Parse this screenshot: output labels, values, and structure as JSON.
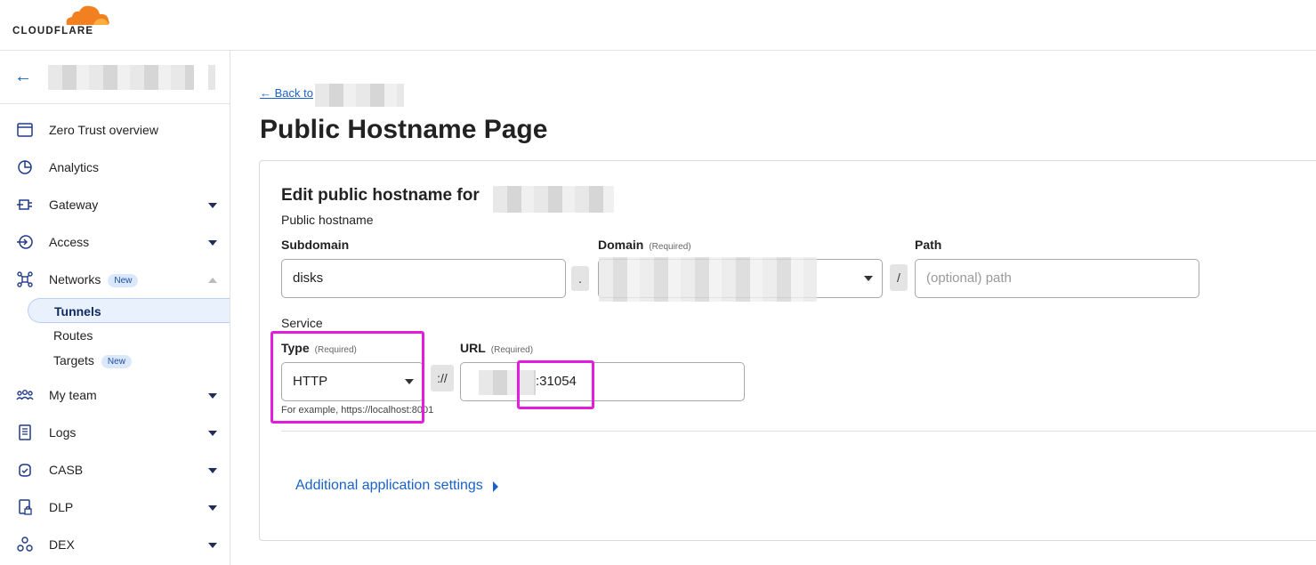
{
  "brand": {
    "logo_text": "CLOUDFLARE",
    "logo_color": "#f38020"
  },
  "sidebar": {
    "items": [
      {
        "label": "Zero Trust overview",
        "icon": "browser-window-icon",
        "caret": false
      },
      {
        "label": "Analytics",
        "icon": "pie-chart-icon",
        "caret": false
      },
      {
        "label": "Gateway",
        "icon": "gateway-icon",
        "caret": true
      },
      {
        "label": "Access",
        "icon": "access-login-icon",
        "caret": true
      },
      {
        "label": "Networks",
        "badge": "New",
        "icon": "network-icon",
        "caret": true,
        "expanded": true
      },
      {
        "label": "My team",
        "icon": "team-icon",
        "caret": true
      },
      {
        "label": "Logs",
        "icon": "logs-icon",
        "caret": true
      },
      {
        "label": "CASB",
        "icon": "casb-icon",
        "caret": true
      },
      {
        "label": "DLP",
        "icon": "dlp-lock-icon",
        "caret": true
      },
      {
        "label": "DEX",
        "icon": "dex-icon",
        "caret": true
      }
    ],
    "sub_items": [
      {
        "label": "Tunnels",
        "active": true
      },
      {
        "label": "Routes"
      },
      {
        "label": "Targets",
        "badge": "New"
      }
    ]
  },
  "main": {
    "back_link": "← Back to",
    "page_title": "Public Hostname Page",
    "card": {
      "title": "Edit public hostname for",
      "section_public": "Public hostname",
      "subdomain": {
        "label": "Subdomain",
        "value": "disks"
      },
      "domain": {
        "label": "Domain",
        "required": "(Required)"
      },
      "path": {
        "label": "Path",
        "placeholder": "(optional) path"
      },
      "dot_sep": ".",
      "slash_sep": "/",
      "section_service": "Service",
      "type": {
        "label": "Type",
        "required": "(Required)",
        "value": "HTTP",
        "hint": "For example, https://localhost:8001"
      },
      "scheme_sep": "://",
      "url": {
        "label": "URL",
        "required": "(Required)",
        "value": ":31054"
      },
      "advanced_link": "Additional application settings"
    }
  },
  "colors": {
    "accent": "#1a62c7",
    "highlight": "#e41ce0"
  }
}
